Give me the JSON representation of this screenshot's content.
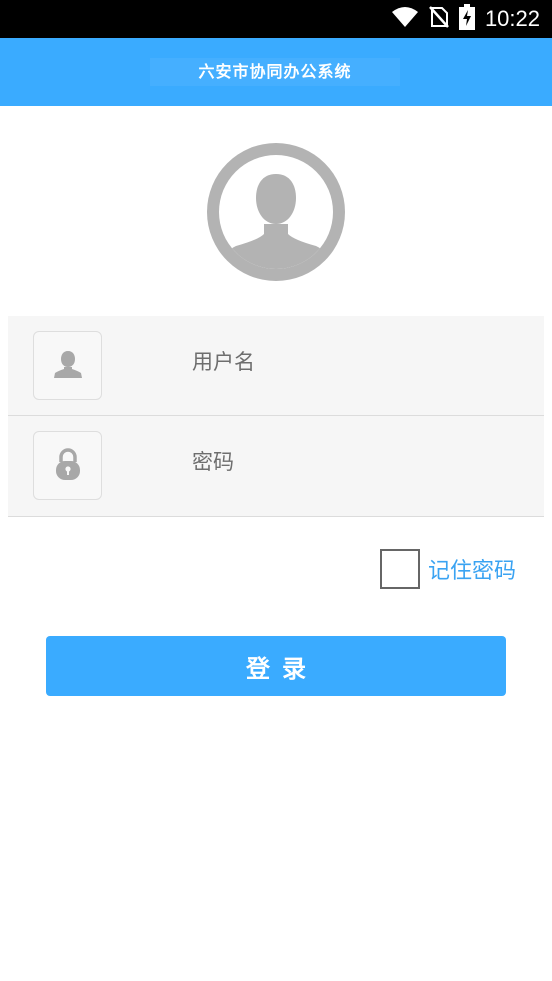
{
  "status_bar": {
    "time": "10:22",
    "icons": [
      "wifi-icon",
      "no-sim-icon",
      "battery-charging-icon"
    ]
  },
  "header": {
    "title": "六安市协同办公系统"
  },
  "login_form": {
    "avatar_icon": "user-avatar-icon",
    "username": {
      "icon": "user-icon",
      "placeholder": "用户名",
      "value": ""
    },
    "password": {
      "icon": "lock-icon",
      "placeholder": "密码",
      "value": ""
    },
    "remember_password": {
      "label": "记住密码",
      "checked": false
    },
    "login_button_label": "登录"
  },
  "colors": {
    "accent": "#3aabff",
    "link": "#3aa3f2",
    "avatar_gray": "#b3b3b3",
    "form_background": "#f6f6f6"
  }
}
